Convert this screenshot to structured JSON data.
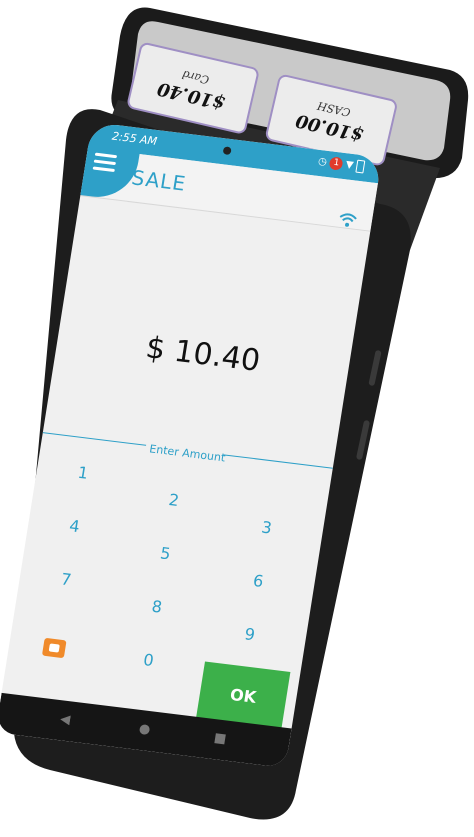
{
  "customer_display": {
    "card": {
      "amount": "$10.40",
      "label": "Card"
    },
    "cash": {
      "amount": "$10.00",
      "label": "CASH"
    }
  },
  "status_bar": {
    "time": "2:55 AM",
    "notification_count": "1"
  },
  "header": {
    "title": "SALE",
    "menu_icon": "hamburger-icon",
    "wifi_icon": "wifi-icon"
  },
  "sale": {
    "amount": "$ 10.40"
  },
  "keypad": {
    "section_label": "Enter Amount",
    "keys": [
      "1",
      "2",
      "3",
      "4",
      "5",
      "6",
      "7",
      "8",
      "9",
      "0"
    ],
    "ok_label": "OK",
    "backspace_icon": "backspace-icon"
  },
  "colors": {
    "accent": "#2ea0c8",
    "ok": "#3cb04a",
    "backspace": "#f08a2a",
    "badge": "#e03b2c"
  }
}
